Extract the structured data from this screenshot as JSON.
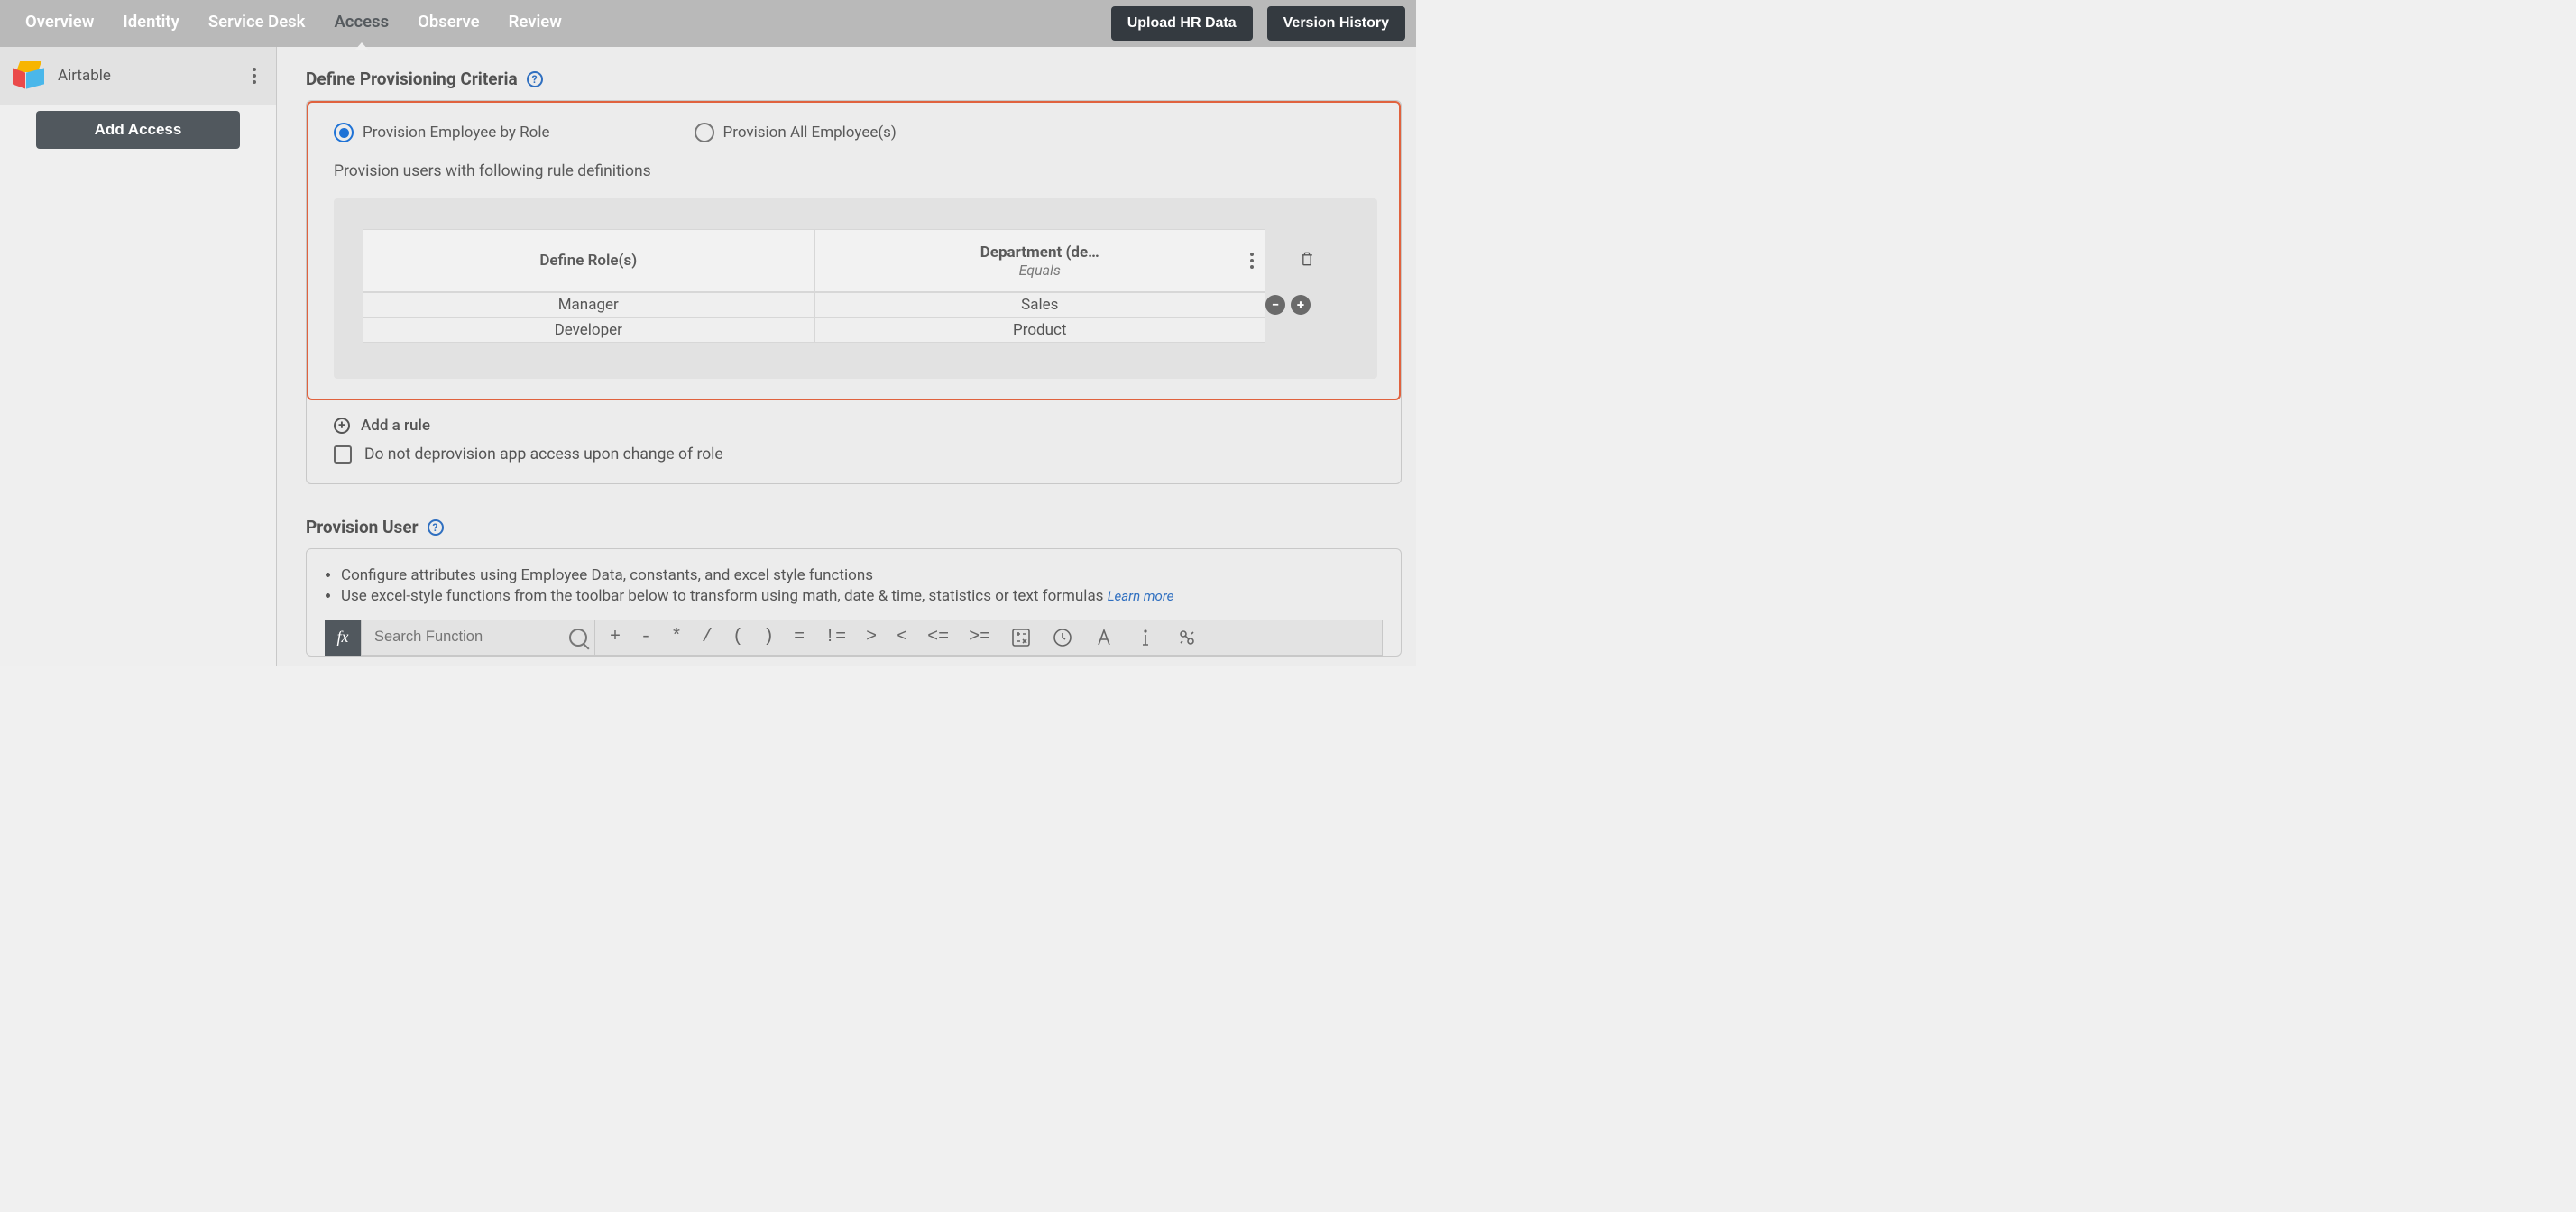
{
  "nav": {
    "tabs": [
      "Overview",
      "Identity",
      "Service Desk",
      "Access",
      "Observe",
      "Review"
    ],
    "active_index": 3,
    "upload_btn": "Upload HR Data",
    "version_btn": "Version History"
  },
  "sidebar": {
    "app_name": "Airtable",
    "add_access_btn": "Add Access"
  },
  "criteria": {
    "title": "Define Provisioning Criteria",
    "by_role_label": "Provision Employee by Role",
    "all_emp_label": "Provision All Employee(s)",
    "subheading": "Provision users with following rule definitions",
    "col_roles": "Define Role(s)",
    "col_attr": "Department (de…",
    "col_op": "Equals",
    "rows": [
      {
        "role": "Manager",
        "value": "Sales"
      },
      {
        "role": "Developer",
        "value": "Product"
      }
    ],
    "add_rule_label": "Add a rule",
    "deprovision_label": "Do not deprovision app access upon change of role"
  },
  "provision_user": {
    "title": "Provision User",
    "bullet1": "Configure attributes using Employee Data, constants, and excel style functions",
    "bullet2": "Use excel-style functions from the toolbar below to transform using math, date & time, statistics or text formulas",
    "learn_more": "Learn more",
    "search_placeholder": "Search Function",
    "ops": [
      "+",
      "-",
      "*",
      "/",
      "(",
      ")",
      "=",
      "!=",
      ">",
      "<",
      "<=",
      ">="
    ]
  }
}
